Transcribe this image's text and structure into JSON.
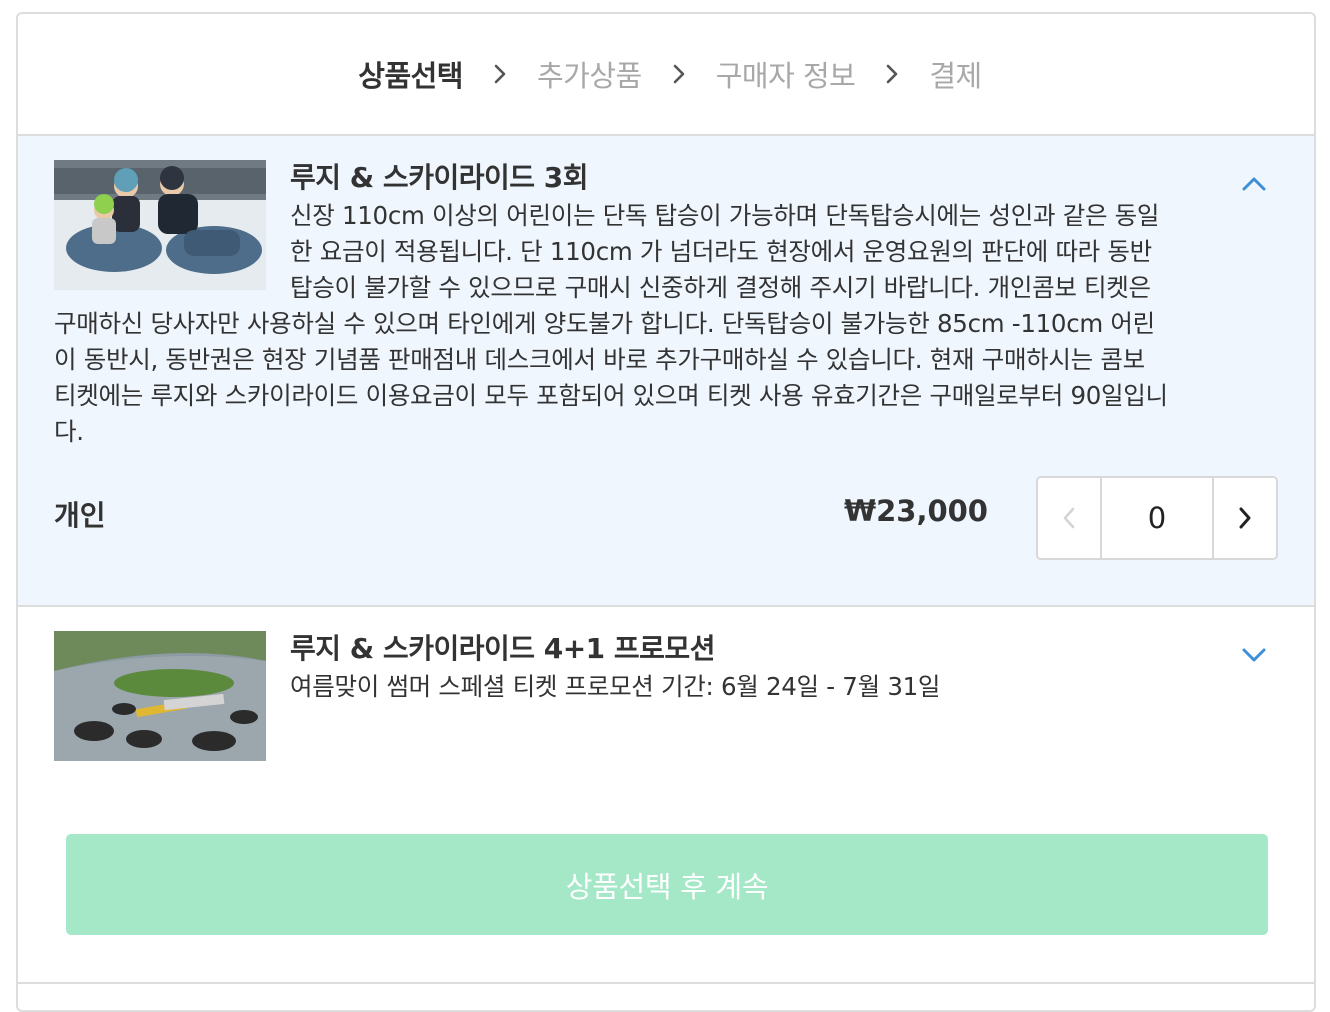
{
  "steps": [
    {
      "label": "상품선택",
      "active": true
    },
    {
      "label": "추가상품",
      "active": false
    },
    {
      "label": "구매자 정보",
      "active": false
    },
    {
      "label": "결제",
      "active": false
    }
  ],
  "products": [
    {
      "title": "루지 & 스카이라이드 3회",
      "description": "신장 110cm 이상의 어린이는 단독 탑승이 가능하며 단독탑승시에는 성인과 같은 동일한 요금이 적용됩니다. 단 110cm 가 넘더라도 현장에서 운영요원의 판단에 따라 동반탑승이 불가할 수 있으므로 구매시 신중하게 결정해 주시기 바랍니다. 개인콤보 티켓은 구매하신 당사자만 사용하실 수 있으며 타인에게 양도불가 합니다. 단독탑승이 불가능한 85cm -110cm 어린이 동반시, 동반권은 현장 기념품 판매점내 데스크에서 바로 추가구매하실 수 있습니다. 현재 구매하시는 콤보 티켓에는 루지와 스카이라이드 이용요금이 모두 포함되어 있으며 티켓 사용 유효기간은 구매일로부터 90일입니다.",
      "expanded": true,
      "options": [
        {
          "label": "개인",
          "price": "₩23,000",
          "quantity": "0"
        }
      ]
    },
    {
      "title": "루지 & 스카이라이드 4+1 프로모션",
      "description": "여름맞이 썸머 스페셜 티켓 프로모션 기간: 6월 24일 - 7월 31일",
      "expanded": false
    }
  ],
  "continue_label": "상품선택 후 계속",
  "colors": {
    "accent": "#3d8fd6",
    "continue_disabled": "#a5e8c8",
    "selected_bg": "#eff6fe"
  },
  "icons": {
    "step_separator": "chevron-right-icon",
    "collapse": "chevron-up-icon",
    "expand": "chevron-down-icon",
    "decrement": "chevron-left-icon",
    "increment": "chevron-right-icon"
  }
}
